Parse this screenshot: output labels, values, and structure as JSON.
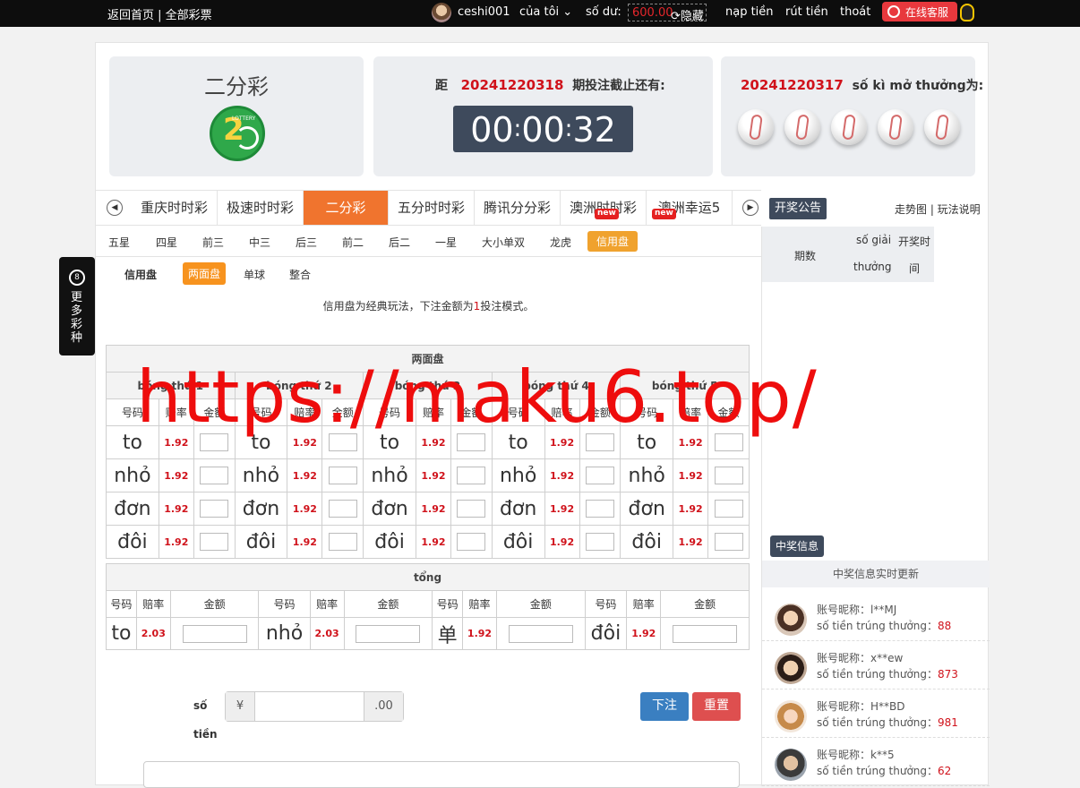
{
  "topbar": {
    "home": "返回首页 | 全部彩票",
    "username": "ceshi001",
    "my": "của tôi",
    "balance_label": "số dư:",
    "balance": "600.00",
    "hide": "隐藏",
    "deposit": "nạp tiền",
    "withdraw": "rút tiền",
    "logout": "thoát",
    "support": "在线客服"
  },
  "game": {
    "name": "二分彩",
    "current_period": "20241220318",
    "countdown_prefix": "距",
    "countdown_suffix": "期投注截止还有:",
    "timer": {
      "hh": "00",
      "mm": "00",
      "ss": "32"
    },
    "last_period": "20241220317",
    "last_suffix": "số kì mở thưởng为:"
  },
  "tabs": [
    "重庆时时彩",
    "极速时时彩",
    "二分彩",
    "五分时时彩",
    "腾讯分分彩",
    "澳洲时时彩",
    "澳洲幸运5"
  ],
  "new_label": "new",
  "notice": "开奖公告",
  "trend_links": "走势图 | 玩法说明",
  "plays": [
    "五星",
    "四星",
    "前三",
    "中三",
    "后三",
    "前二",
    "后二",
    "一星",
    "大小单双",
    "龙虎",
    "信用盘"
  ],
  "subplays": [
    "信用盘",
    "两面盘",
    "单球",
    "整合"
  ],
  "description": {
    "before": "信用盘为经典玩法，下注金额为",
    "num": "1",
    "after": "投注模式。"
  },
  "table1": {
    "title": "两面盘",
    "balls": [
      "bóng thứ 1",
      "bóng thứ 2",
      "bóng thứ 3",
      "bóng thứ 4",
      "bóng thứ 5"
    ],
    "cols": [
      "号码",
      "赔率",
      "金额"
    ],
    "rows": [
      {
        "label": "to",
        "odds": "1.92"
      },
      {
        "label": "nhỏ",
        "odds": "1.92"
      },
      {
        "label": "đơn",
        "odds": "1.92"
      },
      {
        "label": "đôi",
        "odds": "1.92"
      }
    ]
  },
  "table2": {
    "title": "tổng",
    "cols": [
      "号码",
      "赔率",
      "金额"
    ],
    "items": [
      {
        "label": "to",
        "odds": "2.03"
      },
      {
        "label": "nhỏ",
        "odds": "2.03"
      },
      {
        "label": "单",
        "odds": "1.92"
      },
      {
        "label": "đôi",
        "odds": "1.92"
      }
    ]
  },
  "amount": {
    "label1": "số",
    "label2": "tiền",
    "currency": "¥",
    "suffix": ".00",
    "submit": "下注",
    "reset": "重置"
  },
  "sidebar": {
    "col_period": "期数",
    "col_number1": "số giải",
    "col_number2": "thưởng",
    "col_time1": "开奖时",
    "col_time2": "间",
    "winners_button": "中奖信息",
    "winners_header": "中奖信息实时更新",
    "nick_label": "账号昵称：",
    "prize_label": "số tiền trúng thưởng：",
    "winners": [
      {
        "nick": "l**MJ",
        "amount": "88"
      },
      {
        "nick": "x**ew",
        "amount": "873"
      },
      {
        "nick": "H**BD",
        "amount": "981"
      },
      {
        "nick": "k**5",
        "amount": "62"
      }
    ]
  },
  "float_nav": {
    "icon": "8",
    "text": "更多彩种"
  },
  "watermark": "https://maku6.top/",
  "colors": {
    "accent": "#f0742e",
    "danger": "#d0121b",
    "dark": "#3e4a5c",
    "submit": "#3a7fc1",
    "reset": "#de4f4f"
  }
}
